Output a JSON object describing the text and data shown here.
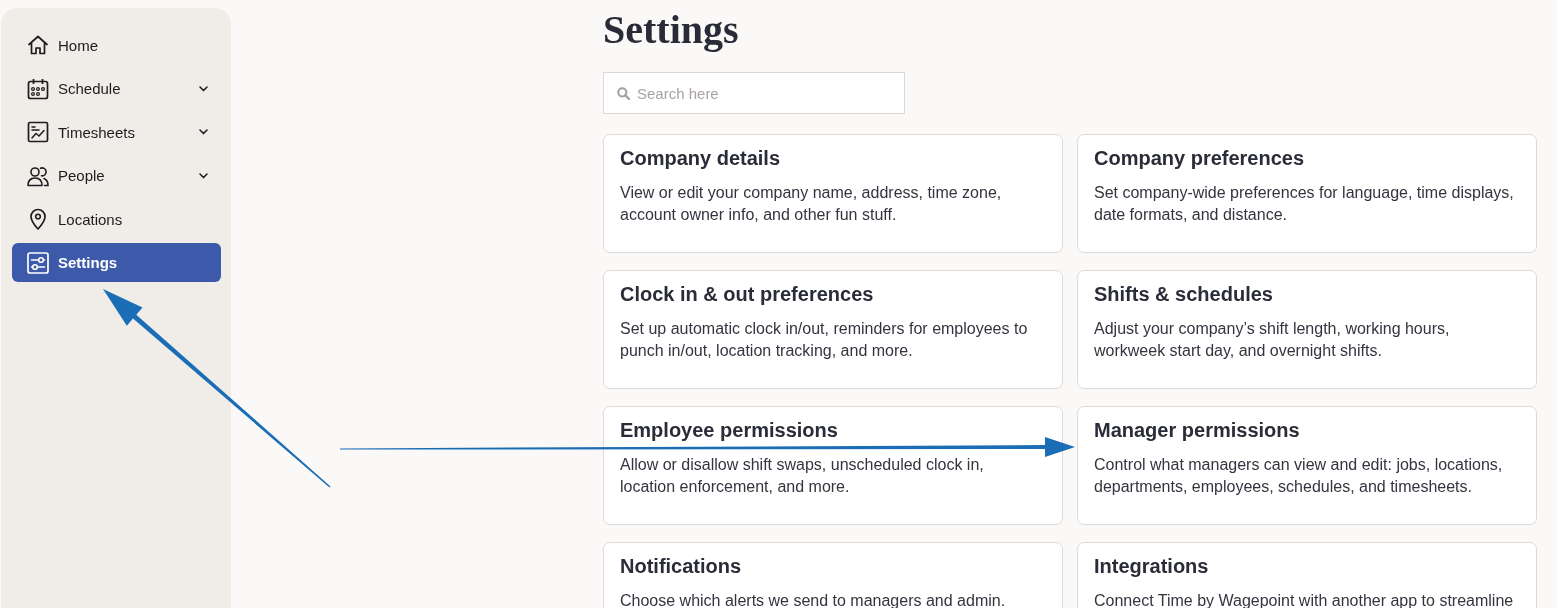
{
  "sidebar": {
    "items": [
      {
        "label": "Home",
        "kind": "link",
        "selected": false
      },
      {
        "label": "Schedule",
        "kind": "group",
        "expanded": false,
        "selected": false
      },
      {
        "label": "Timesheets",
        "kind": "group",
        "expanded": false,
        "selected": false
      },
      {
        "label": "People",
        "kind": "group",
        "expanded": false,
        "selected": false
      },
      {
        "label": "Locations",
        "kind": "link",
        "selected": false
      },
      {
        "label": "Settings",
        "kind": "link",
        "selected": true
      }
    ]
  },
  "page": {
    "title": "Settings",
    "search": {
      "placeholder": "Search here"
    },
    "cards": [
      {
        "title": "Company details",
        "description": "View or edit your company name, address, time zone, account owner info, and other fun stuff."
      },
      {
        "title": "Company preferences",
        "description": "Set company-wide preferences for language, time displays, date formats, and distance."
      },
      {
        "title": "Clock in & out preferences",
        "description": "Set up automatic clock in/out, reminders for employees to punch in/out, location tracking, and more."
      },
      {
        "title": "Shifts & schedules",
        "description": "Adjust your company’s shift length, working hours, workweek start day, and overnight shifts."
      },
      {
        "title": "Employee permissions",
        "description": "Allow or disallow shift swaps, unscheduled clock in, location enforcement, and more."
      },
      {
        "title": "Manager permissions",
        "description": "Control what managers can view and edit: jobs, locations, departments, employees, schedules, and timesheets."
      },
      {
        "title": "Notifications",
        "description": "Choose which alerts we send to managers and admin."
      },
      {
        "title": "Integrations",
        "description": "Connect Time by Wagepoint with another app to streamline"
      }
    ]
  }
}
